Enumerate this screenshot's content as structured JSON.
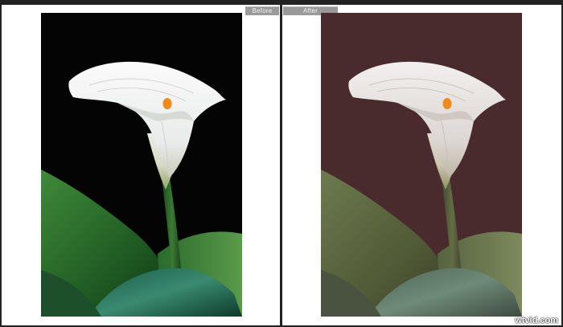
{
  "compare_view": {
    "before_label": "Before",
    "after_label": "After",
    "watermark": "wtvid.com"
  },
  "colors": {
    "before_background": "#040404",
    "after_background": "#4a2b2d",
    "spadix": "#f08a18"
  }
}
